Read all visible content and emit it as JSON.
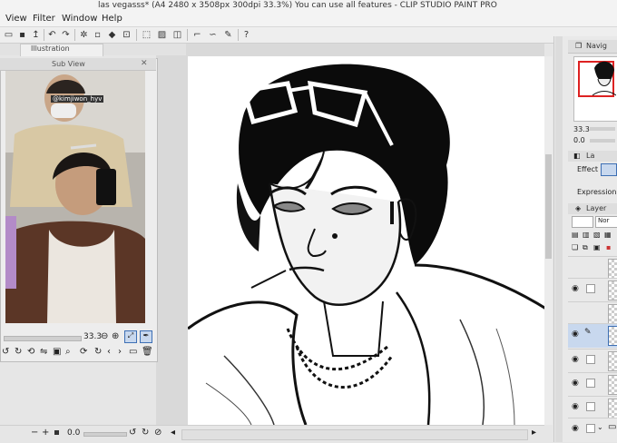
{
  "window": {
    "title": "las vegasss* (A4 2480 x 3508px 300dpi 33.3%)  You can use all features - CLIP STUDIO PAINT PRO"
  },
  "menu": [
    "View",
    "Filter",
    "Window",
    "Help"
  ],
  "tabs": {
    "illustration": "Illustration"
  },
  "subview": {
    "title": "Sub View",
    "zoom": "33.3",
    "photo_caption": "@kimjiwon_hyv"
  },
  "statusbar": {
    "zoom": "0.0"
  },
  "right_panel": {
    "navigator_tab": "Navig",
    "zoom_value": "33.3",
    "angle_value": "0.0",
    "tool_tab": "La",
    "effect_label": "Effect",
    "expression_label": "Expression co",
    "layer_tab": "Layer",
    "blend_mode": "Nor"
  },
  "colors": {
    "accent": "#3d6fb4",
    "selection": "#c8d8ee"
  }
}
